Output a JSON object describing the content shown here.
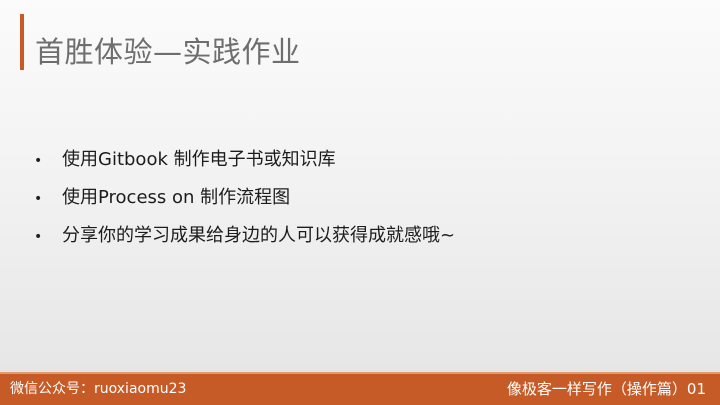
{
  "slide": {
    "title": "首胜体验—实践作业",
    "bullets": [
      "使用Gitbook 制作电子书或知识库",
      "使用Process on 制作流程图",
      "分享你的学习成果给身边的人可以获得成就感哦~"
    ],
    "bullet_marker": "•"
  },
  "footer": {
    "left_text": "微信公众号：ruoxiaomu23",
    "right_text": "像极客一样写作（操作篇）01"
  },
  "colors": {
    "accent": "#c95a22",
    "footer_bg": "#c65b27",
    "title_text": "#6e6e6e"
  }
}
